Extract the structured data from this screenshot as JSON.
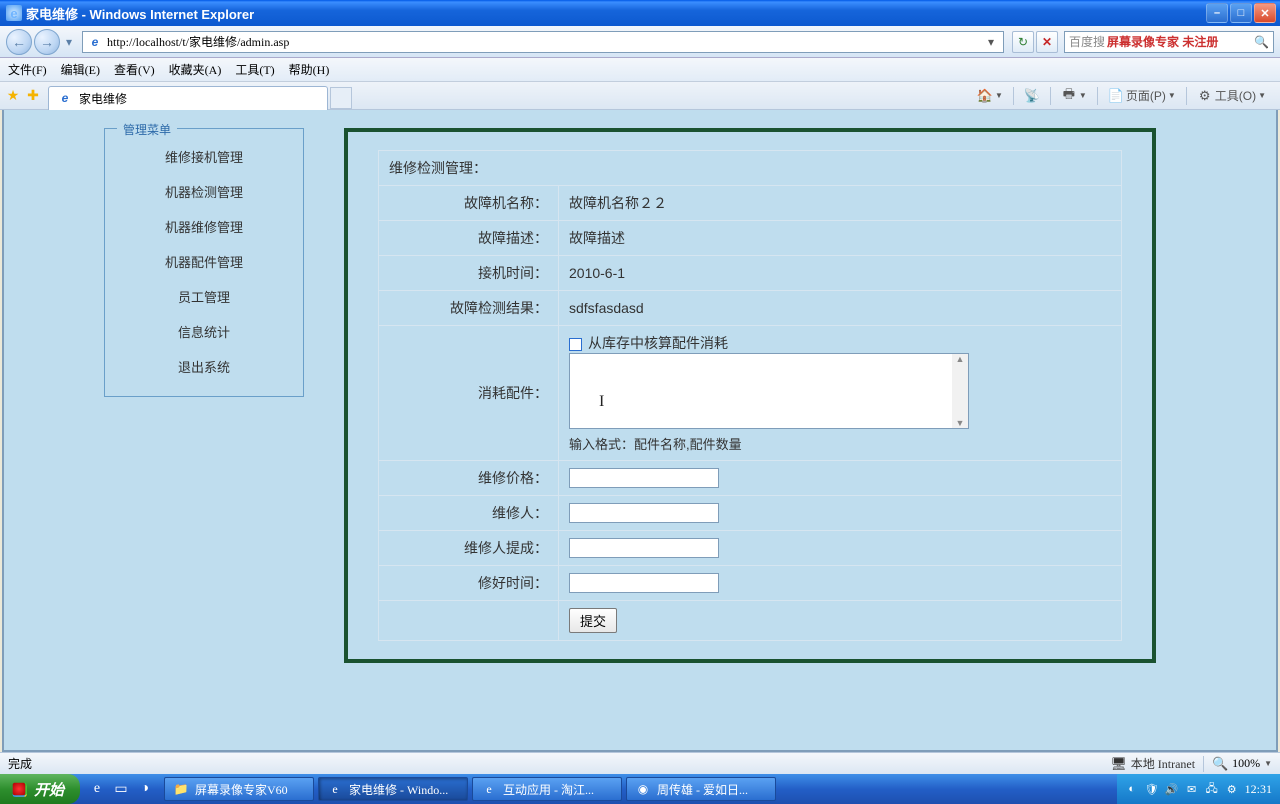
{
  "window": {
    "title": "家电维修 - Windows Internet Explorer"
  },
  "address": {
    "url": "http://localhost/t/家电维修/admin.asp"
  },
  "search": {
    "engine_label": "百度搜",
    "placeholder_1": "屏幕录像专家",
    "placeholder_2": "未注册"
  },
  "menubar": {
    "items": [
      "文件(F)",
      "编辑(E)",
      "查看(V)",
      "收藏夹(A)",
      "工具(T)",
      "帮助(H)"
    ]
  },
  "tab": {
    "title": "家电维修"
  },
  "toolbar_right": {
    "page": "页面(P)",
    "tools": "工具(O)"
  },
  "sidebar": {
    "legend": "管理菜单",
    "items": [
      "维修接机管理",
      "机器检测管理",
      "机器维修管理",
      "机器配件管理",
      "员工管理",
      "信息统计",
      "退出系统"
    ]
  },
  "form": {
    "title": "维修检测管理：",
    "rows": {
      "machine_name": {
        "label": "故障机名称：",
        "value": "故障机名称２２"
      },
      "fault_desc": {
        "label": "故障描述：",
        "value": "故障描述"
      },
      "recv_time": {
        "label": "接机时间：",
        "value": "2010-6-1"
      },
      "fault_result": {
        "label": "故障检测结果：",
        "value": "sdfsfasdasd"
      },
      "parts": {
        "label": "消耗配件：",
        "checkbox_label": "从库存中核算配件消耗",
        "hint": "输入格式：配件名称,配件数量",
        "value": ""
      },
      "repair_price": {
        "label": "维修价格：",
        "value": ""
      },
      "repairer": {
        "label": "维修人：",
        "value": ""
      },
      "commission": {
        "label": "维修人提成：",
        "value": ""
      },
      "done_time": {
        "label": "修好时间：",
        "value": ""
      }
    },
    "submit": "提交"
  },
  "status": {
    "done": "完成",
    "zone": "本地 Intranet",
    "zoom": "100%"
  },
  "taskbar": {
    "start": "开始",
    "items": [
      {
        "icon": "folder",
        "label": "屏幕录像专家V60"
      },
      {
        "icon": "ie",
        "label": "家电维修 - Windo..."
      },
      {
        "icon": "ie",
        "label": "互动应用 - 淘江..."
      },
      {
        "icon": "wmp",
        "label": "周传雄 - 爱如日..."
      }
    ],
    "clock": "12:31"
  }
}
